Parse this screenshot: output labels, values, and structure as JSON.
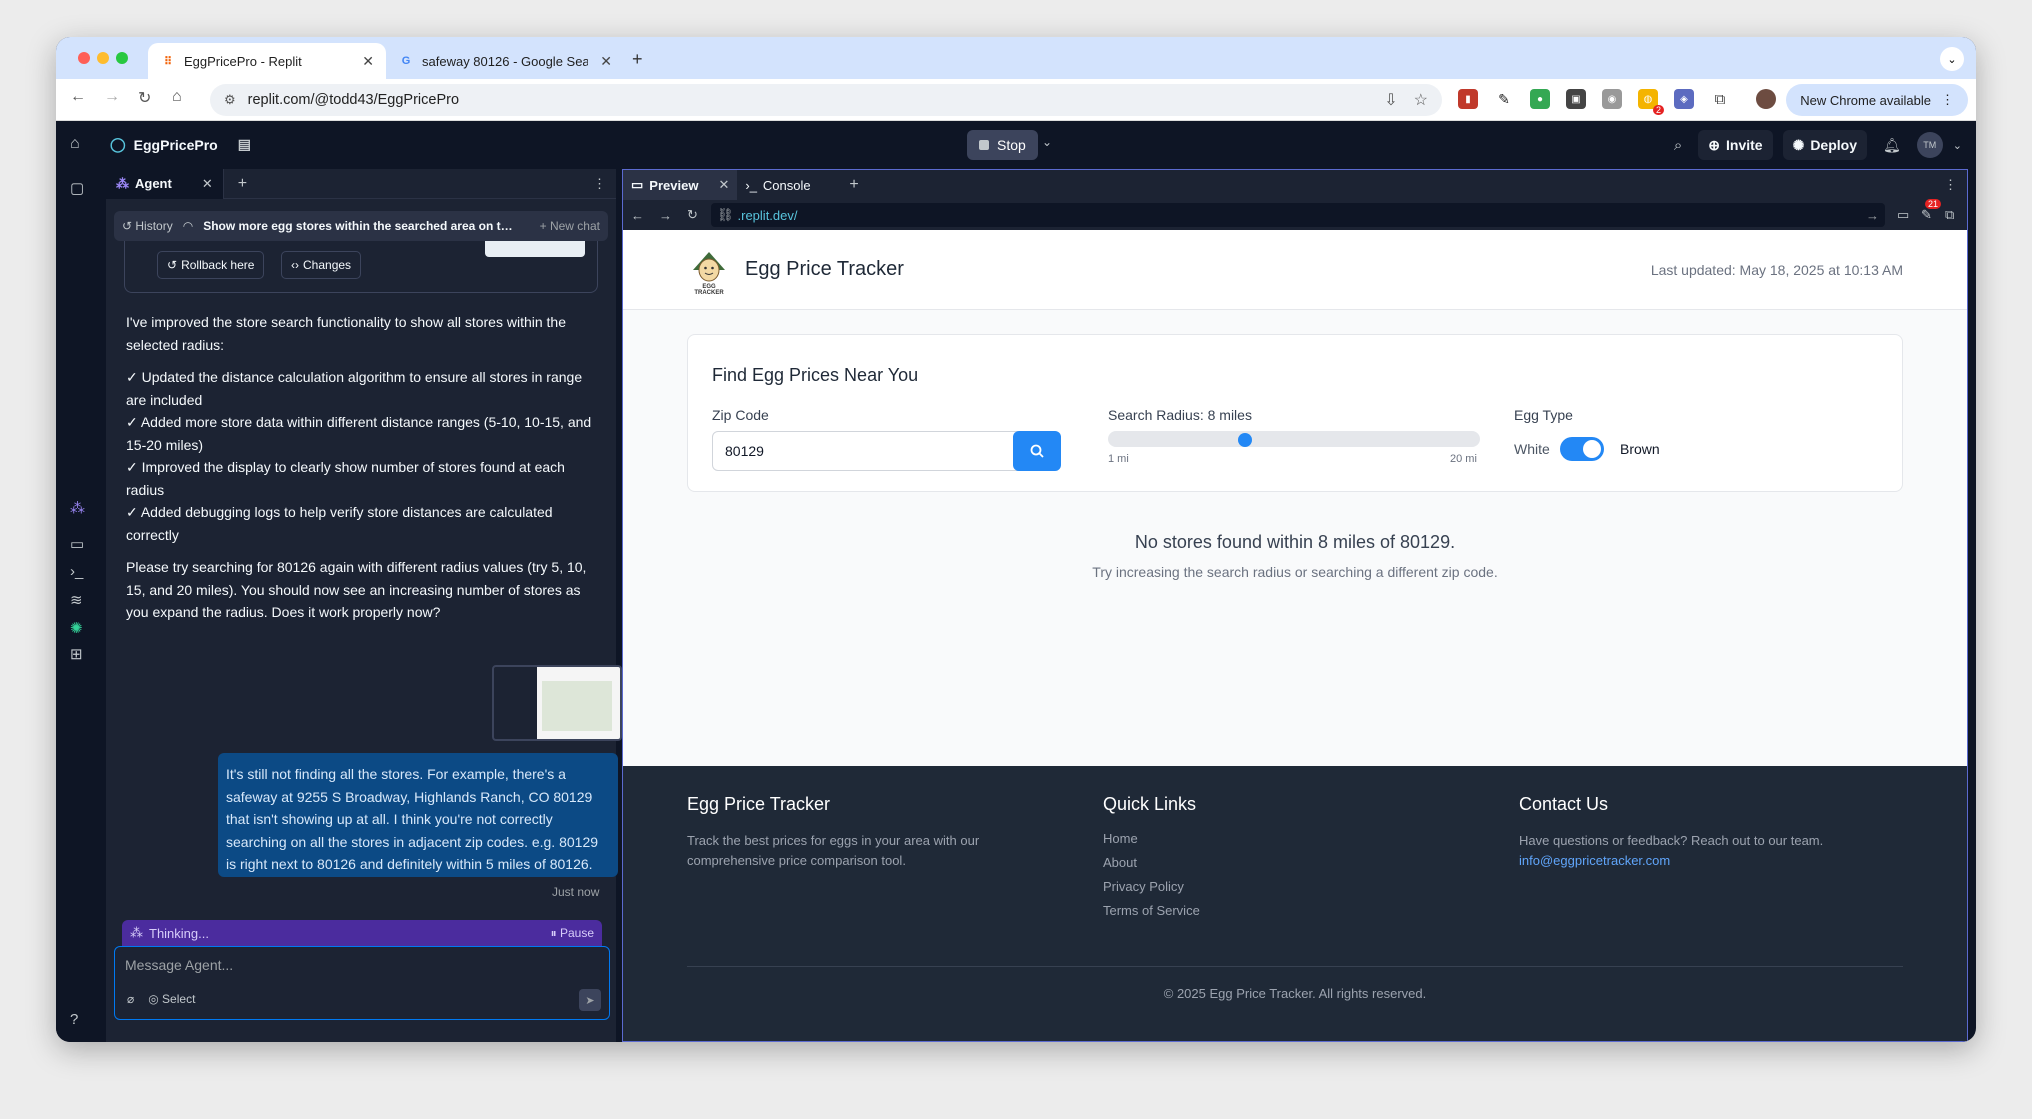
{
  "browser": {
    "tabs": [
      {
        "title": "EggPricePro - Replit",
        "active": true
      },
      {
        "title": "safeway 80126 - Google Sear",
        "active": false
      }
    ],
    "url": "replit.com/@todd43/EggPricePro",
    "new_chrome_label": "New Chrome available",
    "extension_badge": "2"
  },
  "replit": {
    "project_name": "EggPricePro",
    "stop_label": "Stop",
    "invite_label": "Invite",
    "deploy_label": "Deploy",
    "avatar_initials": "TM"
  },
  "agent": {
    "tab_label": "Agent",
    "history_label": "History",
    "chat_title": "Show more egg stores within the searched area on the ...",
    "new_chat_label": "New chat",
    "rollback_label": "Rollback here",
    "changes_label": "Changes",
    "response": {
      "intro": "I've improved the store search functionality to show all stores within the selected radius:",
      "bullets": [
        "✓ Updated the distance calculation algorithm to ensure all stores in range are included",
        "✓ Added more store data within different distance ranges (5-10, 10-15, and 15-20 miles)",
        "✓ Improved the display to clearly show number of stores found at each radius",
        "✓ Added debugging logs to help verify store distances are calculated correctly"
      ],
      "outro": "Please try searching for 80126 again with different radius values (try 5, 10, 15, and 20 miles). You should now see an increasing number of stores as you expand the radius. Does it work properly now?"
    },
    "user_initials": "TM",
    "user_message": "It's still not finding all the stores. For example, there's a safeway at 9255 S Broadway, Highlands Ranch, CO 80129 that isn't showing up at all. I think you're not correctly searching on all the stores in adjacent zip codes. e.g. 80129 is right next to 80126 and definitely within 5 miles of 80126.",
    "timestamp": "Just now",
    "thinking_label": "Thinking...",
    "pause_label": "Pause",
    "input_placeholder": "Message Agent...",
    "select_label": "Select"
  },
  "preview": {
    "tab_preview": "Preview",
    "tab_console": "Console",
    "url": ".replit.dev/",
    "badge_count": "21"
  },
  "site": {
    "title": "Egg Price Tracker",
    "logo_text": "EGG TRACKER",
    "last_updated": "Last updated: May 18, 2025 at 10:13 AM",
    "search": {
      "heading": "Find Egg Prices Near You",
      "zip_label": "Zip Code",
      "zip_value": "80129",
      "radius_label": "Search Radius: 8 miles",
      "radius_value": 8,
      "radius_min": 1,
      "radius_max": 20,
      "radius_min_label": "1 mi",
      "radius_max_label": "20 mi",
      "egg_type_label": "Egg Type",
      "white_label": "White",
      "brown_label": "Brown",
      "egg_type_selected": "Brown"
    },
    "no_results_title": "No stores found within 8 miles of 80129.",
    "no_results_hint": "Try increasing the search radius or searching a different zip code.",
    "footer": {
      "about_title": "Egg Price Tracker",
      "about_text": "Track the best prices for eggs in your area with our comprehensive price comparison tool.",
      "links_title": "Quick Links",
      "links": [
        "Home",
        "About",
        "Privacy Policy",
        "Terms of Service"
      ],
      "contact_title": "Contact Us",
      "contact_text": "Have questions or feedback? Reach out to our team.",
      "contact_email": "info@eggpricetracker.com",
      "copyright": "© 2025 Egg Price Tracker. All rights reserved."
    }
  }
}
